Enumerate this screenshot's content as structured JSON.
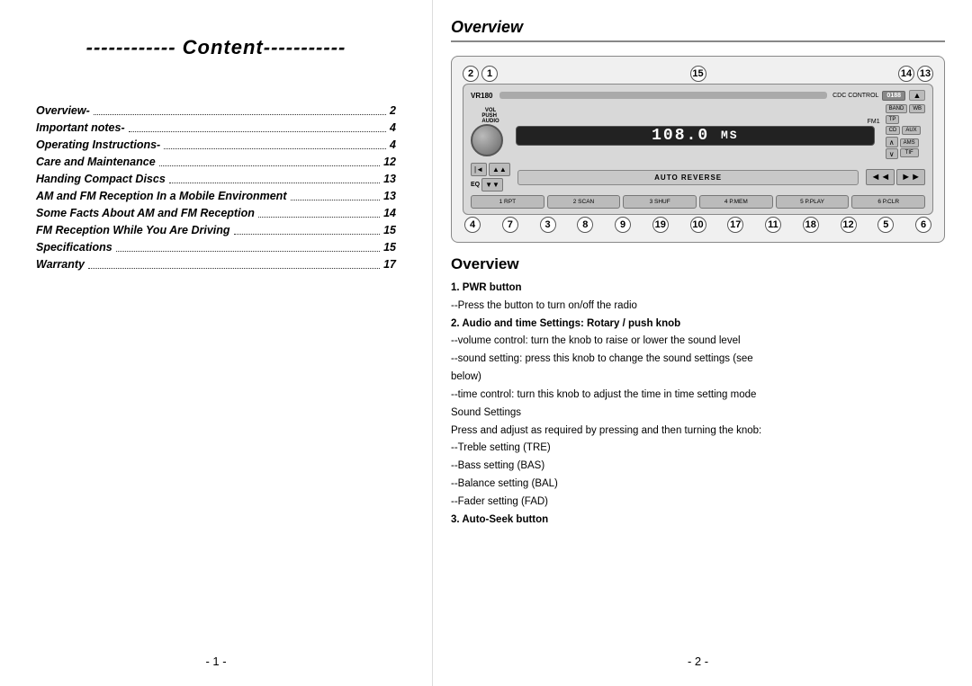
{
  "left": {
    "title": "------------ Content-----------",
    "toc": [
      {
        "label": "Overview-",
        "page": "2"
      },
      {
        "label": "Important notes-",
        "page": "4"
      },
      {
        "label": "Operating Instructions-",
        "page": "4"
      },
      {
        "label": "Care and Maintenance",
        "page": "12"
      },
      {
        "label": "Handing Compact Discs",
        "page": "13"
      },
      {
        "label": "AM and FM Reception In a Mobile Environment",
        "page": "13"
      },
      {
        "label": "Some Facts About AM and FM Reception",
        "page": "14"
      },
      {
        "label": "FM Reception While You Are Driving",
        "page": "15"
      },
      {
        "label": "Specifications",
        "page": "15"
      },
      {
        "label": "Warranty",
        "page": "17"
      }
    ],
    "page_number": "- 1 -"
  },
  "right": {
    "overview_title_top": "Overview",
    "radio": {
      "brand": "VR180",
      "cdc_label": "CDC CONTROL",
      "display_text": "108.0",
      "display_sub": "MS",
      "fm_label": "FM1",
      "auto_reverse": "AUTO REVERSE",
      "buttons": {
        "eq": "EQ",
        "vol": "VOL",
        "band": "BAND",
        "wb": "WB",
        "tp": "TP",
        "cd": "CD",
        "aux": "AUX",
        "ams": "AMS",
        "tif": "TIF"
      },
      "presets": [
        "1 RPT",
        "2 SCAN",
        "3 SHUF",
        "4 P.MEM",
        "5 P.PLAY",
        "6 P.CLR"
      ]
    },
    "top_numbers": [
      "2",
      "1",
      "15",
      "14",
      "13"
    ],
    "bottom_numbers": [
      "4",
      "7",
      "3",
      "8",
      "9",
      "19",
      "10",
      "17",
      "11",
      "18",
      "12",
      "5",
      "6"
    ],
    "overview_section": {
      "title": "Overview",
      "items": [
        {
          "bold": "1. PWR button",
          "text": ""
        },
        {
          "bold": "",
          "text": "--Press the button to turn on/off the radio"
        },
        {
          "bold": "2. Audio and time Settings: Rotary / push knob",
          "text": ""
        },
        {
          "bold": "",
          "text": "--volume control: turn the knob to raise or lower the sound level"
        },
        {
          "bold": "",
          "text": "--sound setting: press this knob to change the sound settings (see"
        },
        {
          "bold": "",
          "text": "  below)"
        },
        {
          "bold": "",
          "text": "--time control: turn this knob to adjust the time in time setting mode"
        },
        {
          "bold": "",
          "text": "  Sound Settings"
        },
        {
          "bold": "",
          "text": "Press and adjust as required by pressing and then turning the knob:"
        },
        {
          "bold": "",
          "text": "--Treble setting (TRE)"
        },
        {
          "bold": "",
          "text": "--Bass setting (BAS)"
        },
        {
          "bold": "",
          "text": "--Balance setting (BAL)"
        },
        {
          "bold": "",
          "text": "--Fader setting (FAD)"
        },
        {
          "bold": "3. Auto-Seek button",
          "text": ""
        }
      ]
    },
    "page_number": "- 2 -"
  }
}
